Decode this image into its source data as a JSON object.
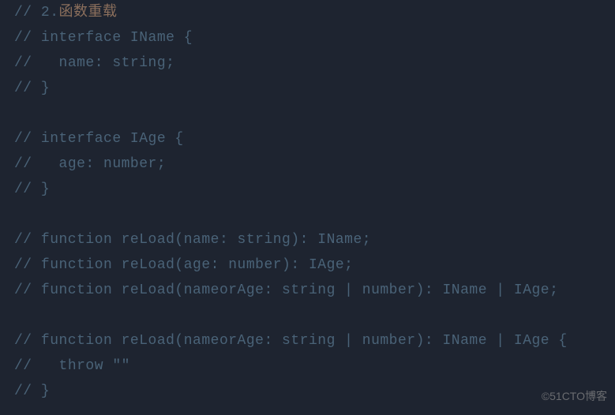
{
  "code": {
    "lines": [
      {
        "prefix": "// ",
        "content": "2.",
        "cjk": "函数重载"
      },
      {
        "prefix": "// ",
        "content": "interface IName {"
      },
      {
        "prefix": "//   ",
        "content": "name: string;"
      },
      {
        "prefix": "// ",
        "content": "}"
      },
      {
        "prefix": "",
        "content": ""
      },
      {
        "prefix": "// ",
        "content": "interface IAge {"
      },
      {
        "prefix": "//   ",
        "content": "age: number;"
      },
      {
        "prefix": "// ",
        "content": "}"
      },
      {
        "prefix": "",
        "content": ""
      },
      {
        "prefix": "// ",
        "content": "function reLoad(name: string): IName;"
      },
      {
        "prefix": "// ",
        "content": "function reLoad(age: number): IAge;"
      },
      {
        "prefix": "// ",
        "content": "function reLoad(nameorAge: string | number): IName | IAge;"
      },
      {
        "prefix": "",
        "content": ""
      },
      {
        "prefix": "// ",
        "content": "function reLoad(nameorAge: string | number): IName | IAge {"
      },
      {
        "prefix": "//   ",
        "content": "throw \"\""
      },
      {
        "prefix": "// ",
        "content": "}"
      }
    ]
  },
  "watermark": "©51CTO博客"
}
